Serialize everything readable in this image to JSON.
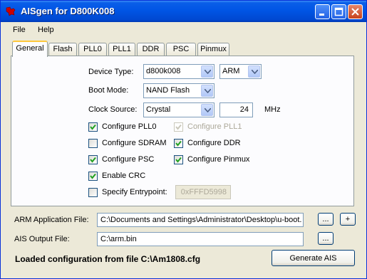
{
  "window": {
    "title": "AISgen for D800K008"
  },
  "menu": {
    "items": [
      "File",
      "Help"
    ]
  },
  "tabs": [
    "General",
    "Flash",
    "PLL0",
    "PLL1",
    "DDR",
    "PSC",
    "Pinmux"
  ],
  "active_tab": "General",
  "general": {
    "device_type_label": "Device Type:",
    "device_type_value": "d800k008",
    "core_value": "ARM",
    "boot_mode_label": "Boot Mode:",
    "boot_mode_value": "NAND Flash",
    "clock_source_label": "Clock Source:",
    "clock_source_value": "Crystal",
    "clock_mhz_value": "24",
    "clock_unit": "MHz",
    "checkboxes": [
      {
        "label": "Configure PLL0",
        "checked": true,
        "enabled": true
      },
      {
        "label": "Configure PLL1",
        "checked": true,
        "enabled": false
      },
      {
        "label": "Configure SDRAM",
        "checked": false,
        "enabled": true
      },
      {
        "label": "Configure DDR",
        "checked": true,
        "enabled": true
      },
      {
        "label": "Configure PSC",
        "checked": true,
        "enabled": true
      },
      {
        "label": "Configure Pinmux",
        "checked": true,
        "enabled": true
      },
      {
        "label": "Enable CRC",
        "checked": true,
        "enabled": true
      },
      {
        "label": "Specify Entrypoint:",
        "checked": false,
        "enabled": true
      }
    ],
    "entrypoint_value": "0xFFFD5998"
  },
  "files": {
    "arm_app_label": "ARM Application File:",
    "arm_app_value": "C:\\Documents and Settings\\Administrator\\Desktop\\u-boot.",
    "ais_output_label": "AIS Output File:",
    "ais_output_value": "C:\\arm.bin",
    "browse_label": "...",
    "add_label": "+"
  },
  "status_text": "Loaded configuration from file C:\\Am1808.cfg",
  "generate_label": "Generate AIS",
  "colors": {
    "title_bar": "#0055e5",
    "tab_highlight": "#ffc83c",
    "app_icon": "#cc0000"
  },
  "icons": [
    "ti-logo-icon",
    "minimize-icon",
    "maximize-icon",
    "close-icon",
    "dropdown-arrow-icon",
    "checkmark-icon"
  ]
}
